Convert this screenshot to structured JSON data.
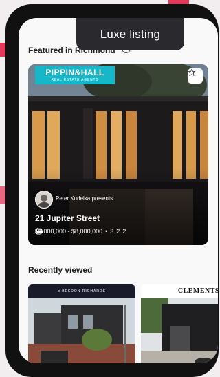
{
  "callout": {
    "text": "Luxe listing"
  },
  "featured": {
    "title": "Featured in Richmond",
    "info_icon": "info-circle-icon",
    "card": {
      "agency_name": "PIPPIN&HALL",
      "agency_tagline": "REAL ESTATE AGENTS",
      "agent_text": "Peter Kudelka presents",
      "address": "21 Jupiter Street",
      "price": "$7,000,000 - $8,000,000",
      "bedrooms": "3",
      "bathrooms": "2",
      "parking": "2",
      "icons": {
        "favorite": "star-icon",
        "bed": "bed-icon",
        "bath": "bath-icon",
        "car": "car-icon"
      }
    }
  },
  "recent": {
    "title": "Recently viewed",
    "items": [
      {
        "agency_name": "b BEKDON RICHARDS"
      },
      {
        "agency_name": "CLEMENTS"
      }
    ]
  },
  "colors": {
    "accent": "#e5395c",
    "agency_teal": "#16b7c8",
    "callout_bg": "#2a2a2e"
  }
}
